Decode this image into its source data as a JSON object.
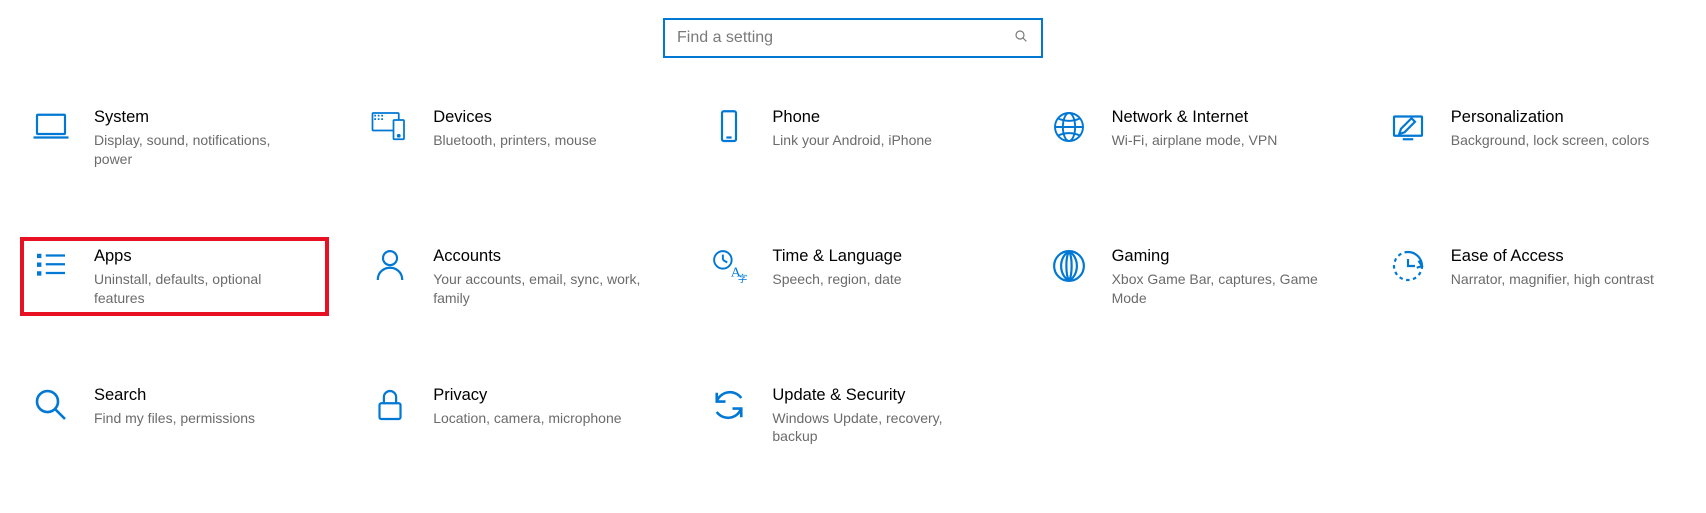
{
  "search": {
    "placeholder": "Find a setting"
  },
  "tiles": [
    {
      "icon": "laptop",
      "title": "System",
      "desc": "Display, sound, notifications, power",
      "highlight": false
    },
    {
      "icon": "devices",
      "title": "Devices",
      "desc": "Bluetooth, printers, mouse",
      "highlight": false
    },
    {
      "icon": "phone",
      "title": "Phone",
      "desc": "Link your Android, iPhone",
      "highlight": false
    },
    {
      "icon": "globe",
      "title": "Network & Internet",
      "desc": "Wi-Fi, airplane mode, VPN",
      "highlight": false
    },
    {
      "icon": "personalize",
      "title": "Personalization",
      "desc": "Background, lock screen, colors",
      "highlight": false
    },
    {
      "icon": "apps",
      "title": "Apps",
      "desc": "Uninstall, defaults, optional features",
      "highlight": true
    },
    {
      "icon": "person",
      "title": "Accounts",
      "desc": "Your accounts, email, sync, work, family",
      "highlight": false
    },
    {
      "icon": "time-lang",
      "title": "Time & Language",
      "desc": "Speech, region, date",
      "highlight": false
    },
    {
      "icon": "gaming",
      "title": "Gaming",
      "desc": "Xbox Game Bar, captures, Game Mode",
      "highlight": false
    },
    {
      "icon": "ease",
      "title": "Ease of Access",
      "desc": "Narrator, magnifier, high contrast",
      "highlight": false
    },
    {
      "icon": "search",
      "title": "Search",
      "desc": "Find my files, permissions",
      "highlight": false
    },
    {
      "icon": "privacy",
      "title": "Privacy",
      "desc": "Location, camera, microphone",
      "highlight": false
    },
    {
      "icon": "update",
      "title": "Update & Security",
      "desc": "Windows Update, recovery, backup",
      "highlight": false
    }
  ]
}
